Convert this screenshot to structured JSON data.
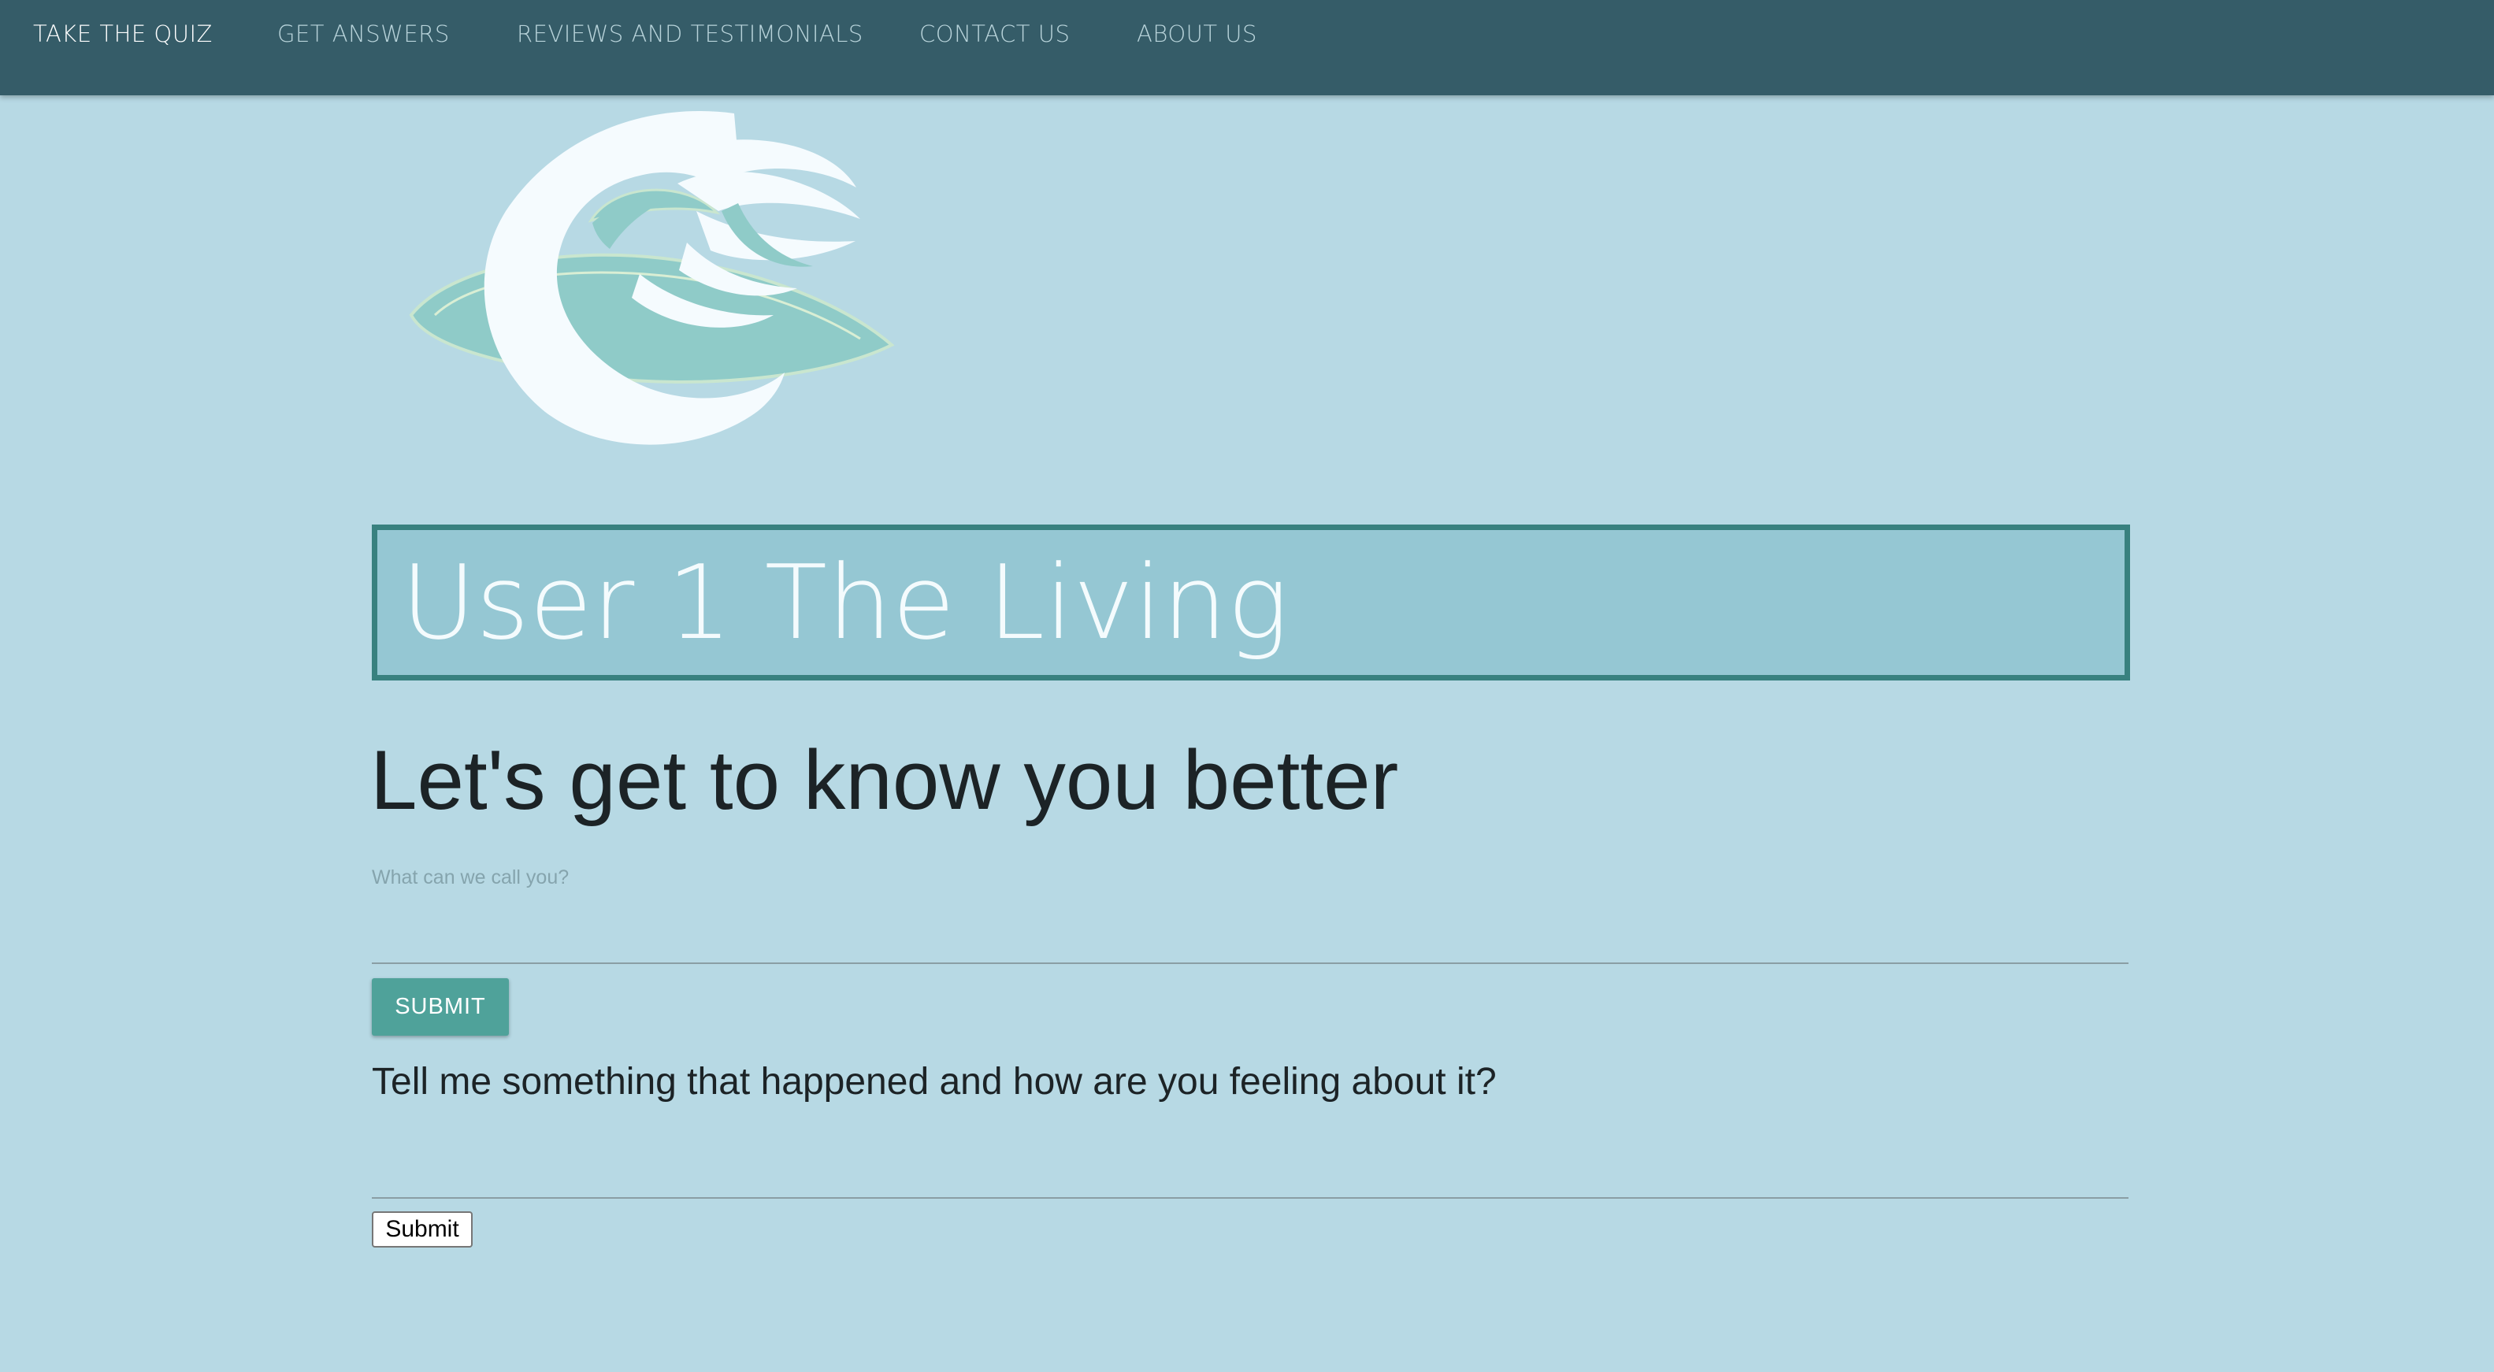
{
  "nav": {
    "items": [
      {
        "label": "TAKE THE QUIZ",
        "active": true
      },
      {
        "label": "GET ANSWERS",
        "active": false
      },
      {
        "label": "REVIEWS AND TESTIMONIALS",
        "active": false
      },
      {
        "label": "CONTACT US",
        "active": false
      },
      {
        "label": "ABOUT US",
        "active": false
      }
    ]
  },
  "logo": {
    "icon": "wave-logo-icon"
  },
  "banner": {
    "title": "User 1 The Living"
  },
  "main": {
    "heading": "Let's get to know you better",
    "name_field": {
      "label": "What can we call you?",
      "value": ""
    },
    "name_submit_label": "SUBMIT",
    "question": "Tell me something that happened and how are you feeling about it?",
    "story_field": {
      "value": ""
    },
    "story_submit_label": "Submit"
  },
  "colors": {
    "background": "#b7d9e4",
    "navbar": "#355c68",
    "banner_fill": "#95c7d3",
    "banner_border": "#38817f",
    "accent_button": "#4fa29a"
  }
}
